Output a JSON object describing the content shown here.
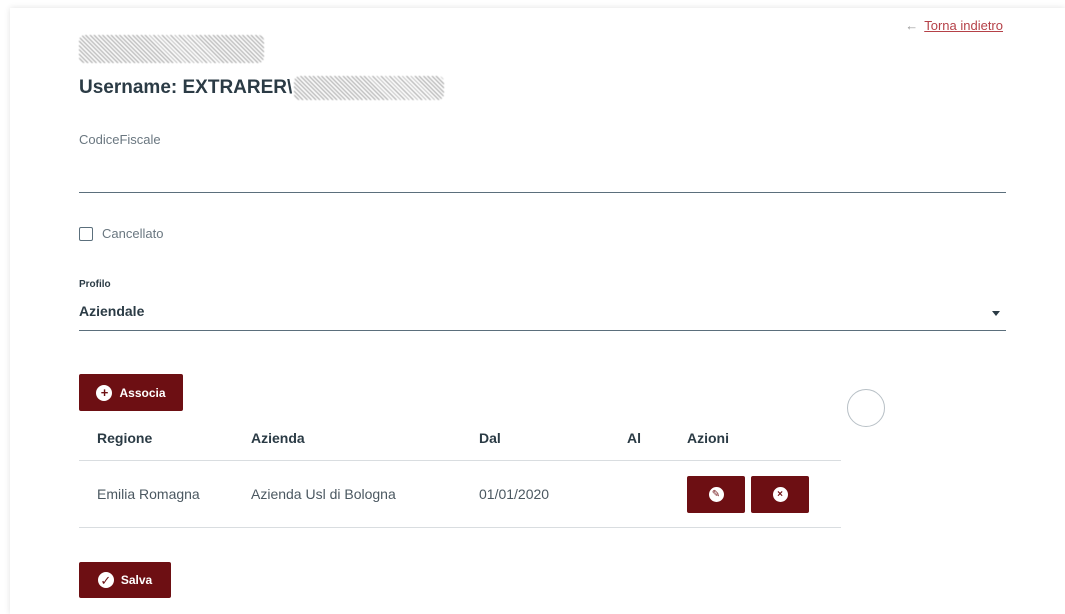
{
  "header": {
    "back_label": "Torna indietro",
    "back_arrow": "←",
    "username_label": "Username: EXTRARER\\"
  },
  "form": {
    "codice_fiscale_label": "CodiceFiscale",
    "codice_fiscale_value": "",
    "cancellato_label": "Cancellato",
    "cancellato_checked": false,
    "profilo_label": "Profilo",
    "profilo_value": "Aziendale"
  },
  "buttons": {
    "associa_label": "Associa",
    "associa_icon": "+",
    "salva_label": "Salva",
    "salva_icon": "✓"
  },
  "table": {
    "columns": [
      "Regione",
      "Azienda",
      "Dal",
      "Al",
      "Azioni"
    ],
    "rows": [
      {
        "regione": "Emilia Romagna",
        "azienda": "Azienda Usl di Bologna",
        "dal": "01/01/2020",
        "al": "",
        "edit_icon": "✎",
        "delete_icon": "×"
      }
    ]
  },
  "colors": {
    "brand": "#6d0f13",
    "link": "#b54148",
    "text": "#2b3b45"
  }
}
